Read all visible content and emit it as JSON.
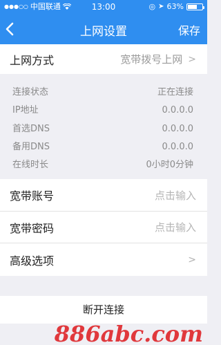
{
  "status_bar": {
    "carrier": "中国联通",
    "time": "13:00",
    "battery_percent": "63%",
    "battery_level": 0.63
  },
  "nav": {
    "title": "上网设置",
    "save_label": "保存"
  },
  "connection_type": {
    "label": "上网方式",
    "value": "宽带拨号上网"
  },
  "status_info": [
    {
      "key": "连接状态",
      "value": "正在连接"
    },
    {
      "key": "IP地址",
      "value": "0.0.0.0"
    },
    {
      "key": "首选DNS",
      "value": "0.0.0.0"
    },
    {
      "key": "备用DNS",
      "value": "0.0.0.0"
    },
    {
      "key": "在线时长",
      "value": "0小时0分钟"
    }
  ],
  "account": {
    "label": "宽带账号",
    "placeholder": "点击输入"
  },
  "password": {
    "label": "宽带密码",
    "placeholder": "点击输入"
  },
  "advanced": {
    "label": "高级选项"
  },
  "disconnect_label": "断开连接",
  "watermark": "886abc.com",
  "colors": {
    "header": "#2f8ef0",
    "background": "#efeff4",
    "watermark": "#e0383c"
  }
}
